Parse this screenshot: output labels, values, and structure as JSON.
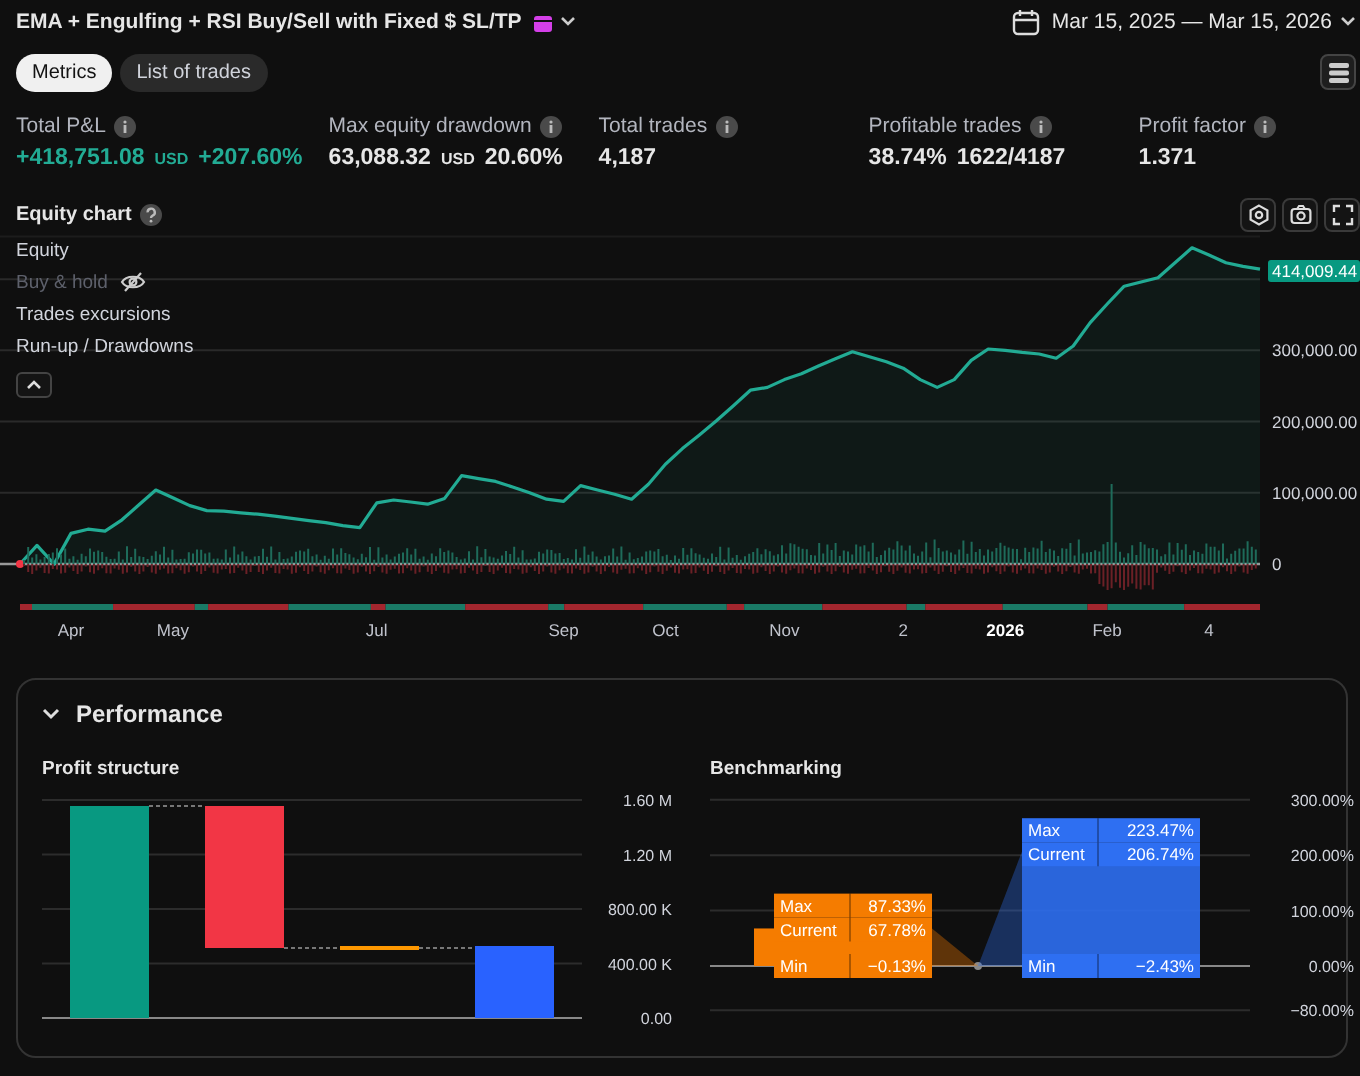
{
  "header": {
    "title": "EMA + Engulfing + RSI Buy/Sell with Fixed $ SL/TP",
    "date_range": "Mar 15, 2025 — Mar 15, 2026"
  },
  "tabs": [
    {
      "label": "Metrics",
      "selected": true
    },
    {
      "label": "List of trades",
      "selected": false
    }
  ],
  "metrics": [
    {
      "label": "Total P&L",
      "parts": [
        {
          "text": "+418,751.08",
          "kind": "value",
          "positive": true
        },
        {
          "text": "USD",
          "kind": "unit",
          "positive": true
        },
        {
          "text": "+207.60%",
          "kind": "value",
          "positive": true
        }
      ]
    },
    {
      "label": "Max equity drawdown",
      "parts": [
        {
          "text": "63,088.32",
          "kind": "value",
          "positive": false
        },
        {
          "text": "USD",
          "kind": "unit",
          "positive": false
        },
        {
          "text": "20.60%",
          "kind": "value",
          "positive": false
        }
      ]
    },
    {
      "label": "Total trades",
      "parts": [
        {
          "text": "4,187",
          "kind": "value",
          "positive": false
        }
      ]
    },
    {
      "label": "Profitable trades",
      "parts": [
        {
          "text": "38.74%",
          "kind": "value",
          "positive": false
        },
        {
          "text": "1622/4187",
          "kind": "value",
          "positive": false
        }
      ]
    },
    {
      "label": "Profit factor",
      "parts": [
        {
          "text": "1.371",
          "kind": "value",
          "positive": false
        }
      ]
    }
  ],
  "equity": {
    "title": "Equity chart",
    "legend": [
      {
        "label": "Equity",
        "visible": true
      },
      {
        "label": "Buy & hold",
        "visible": false
      },
      {
        "label": "Trades excursions",
        "visible": true
      },
      {
        "label": "Run-up / Drawdowns",
        "visible": true
      }
    ],
    "last_value": "414,009.44",
    "chart_data": {
      "type": "line",
      "grid": true,
      "ylim": [
        0,
        460000
      ],
      "categories": [
        null,
        null,
        null,
        "Apr",
        null,
        null,
        null,
        null,
        null,
        "May",
        null,
        null,
        null,
        null,
        null,
        null,
        null,
        null,
        null,
        null,
        null,
        "Jul",
        null,
        null,
        null,
        null,
        null,
        null,
        null,
        null,
        null,
        null,
        "Sep",
        null,
        null,
        null,
        null,
        null,
        "Oct",
        null,
        null,
        null,
        null,
        null,
        null,
        "Nov",
        null,
        null,
        null,
        null,
        null,
        null,
        "2",
        null,
        null,
        null,
        null,
        null,
        "2026",
        null,
        null,
        null,
        null,
        null,
        "Feb",
        null,
        null,
        null,
        null,
        null,
        "4",
        null,
        null,
        null
      ],
      "series": [
        {
          "color": "#22ab94",
          "values": [
            0,
            26000,
            0,
            43000,
            49000,
            46000,
            62000,
            83000,
            104000,
            93000,
            82000,
            75000,
            74000,
            72000,
            70000,
            67000,
            64000,
            61000,
            58000,
            54000,
            51000,
            86000,
            90000,
            87000,
            84000,
            92000,
            124000,
            120000,
            116000,
            108000,
            100000,
            91000,
            88000,
            110000,
            104000,
            98000,
            91000,
            112000,
            140000,
            162000,
            181000,
            201000,
            222000,
            244000,
            248000,
            259000,
            267000,
            278000,
            288000,
            298000,
            291000,
            284000,
            275000,
            259000,
            248000,
            259000,
            286000,
            302000,
            300000,
            297000,
            295000,
            289000,
            306000,
            339000,
            365000,
            390000,
            396000,
            402000,
            423000,
            444000,
            434000,
            423000,
            418000,
            414000
          ]
        }
      ],
      "yticks": [
        {
          "value": 0,
          "label": "0"
        },
        {
          "value": 100000,
          "label": "100,000.00"
        },
        {
          "value": 200000,
          "label": "200,000.00"
        },
        {
          "value": 300000,
          "label": "300,000.00"
        }
      ]
    }
  },
  "performance": {
    "title": "Performance",
    "expanded": true,
    "profit_structure": {
      "title": "Profit structure",
      "yticks": [
        "1.60 M",
        "1.20 M",
        "800.00 K",
        "400.00 K",
        "0.00"
      ],
      "bars": [
        {
          "color": "#089981"
        },
        {
          "color": "#f23645"
        },
        {
          "color": "#ff9800"
        },
        {
          "color": "#2962ff"
        }
      ]
    },
    "benchmarking": {
      "title": "Benchmarking",
      "yticks": [
        "300.00%",
        "200.00%",
        "100.00%",
        "0.00%",
        "−80.00%"
      ],
      "series": [
        {
          "color": "#f57c00",
          "max": "87.33%",
          "current": "67.78%",
          "min": "−0.13%",
          "labels": [
            "Max",
            "Current",
            "Min"
          ]
        },
        {
          "color": "#2e6ff2",
          "max": "223.47%",
          "current": "206.74%",
          "min": "−2.43%",
          "labels": [
            "Max",
            "Current",
            "Min"
          ]
        }
      ]
    }
  }
}
